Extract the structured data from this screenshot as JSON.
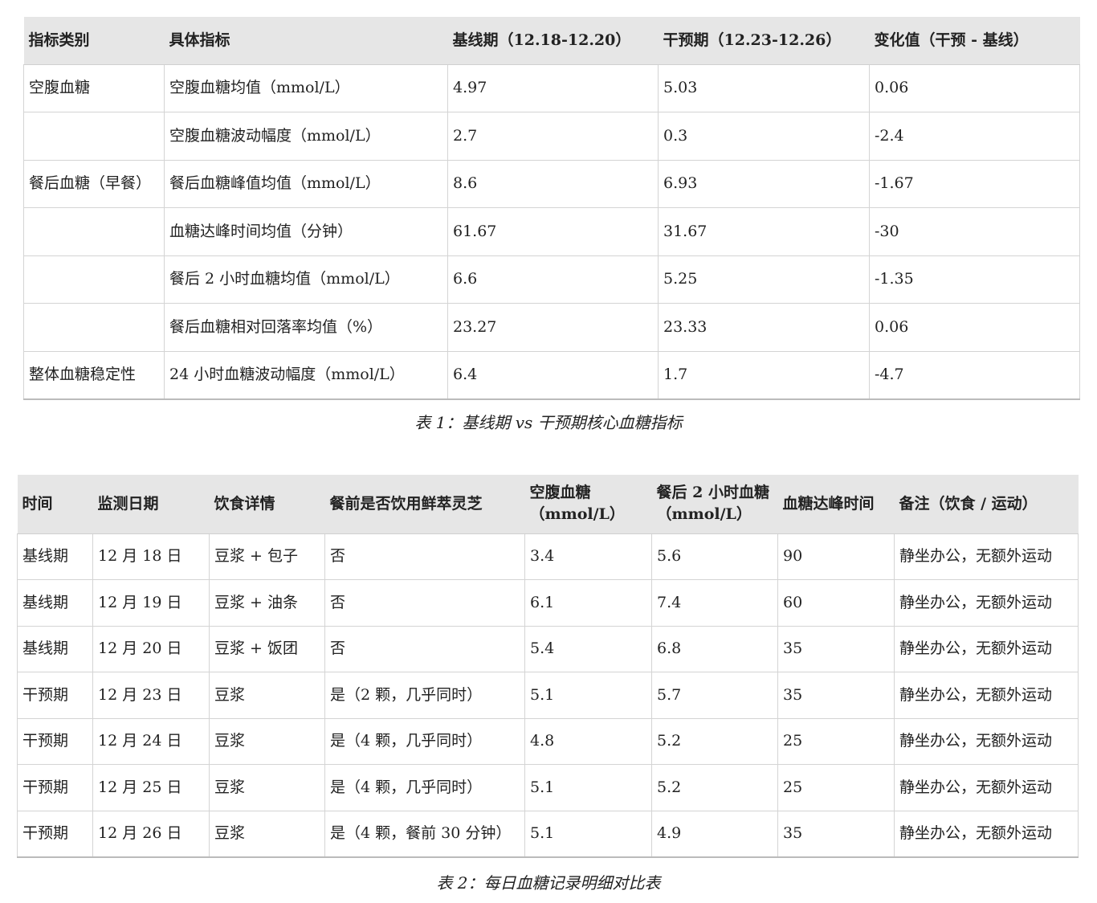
{
  "table1": {
    "headers": [
      "指标类别",
      "具体指标",
      "基线期（12.18-12.20）",
      "干预期（12.23-12.26）",
      "变化值（干预 - 基线）"
    ],
    "rows": [
      [
        "空腹血糖",
        "空腹血糖均值（mmol/L）",
        "4.97",
        "5.03",
        "0.06"
      ],
      [
        "",
        "空腹血糖波动幅度（mmol/L）",
        "2.7",
        "0.3",
        "-2.4"
      ],
      [
        "餐后血糖（早餐）",
        "餐后血糖峰值均值（mmol/L）",
        "8.6",
        "6.93",
        "-1.67"
      ],
      [
        "",
        "血糖达峰时间均值（分钟）",
        "61.67",
        "31.67",
        "-30"
      ],
      [
        "",
        "餐后 2 小时血糖均值（mmol/L）",
        "6.6",
        "5.25",
        "-1.35"
      ],
      [
        "",
        "餐后血糖相对回落率均值（%）",
        "23.27",
        "23.33",
        "0.06"
      ],
      [
        "整体血糖稳定性",
        "24 小时血糖波动幅度（mmol/L）",
        "6.4",
        "1.7",
        "-4.7"
      ]
    ],
    "caption": "表 1：基线期 vs 干预期核心血糖指标"
  },
  "table2": {
    "headers": [
      "时间",
      "监测日期",
      "饮食详情",
      "餐前是否饮用鲜萃灵芝",
      "空腹血糖（mmol/L）",
      "餐后 2 小时血糖（mmol/L）",
      "血糖达峰时间",
      "备注（饮食 / 运动）"
    ],
    "rows": [
      [
        "基线期",
        "12 月 18 日",
        "豆浆 + 包子",
        "否",
        "3.4",
        "5.6",
        "90",
        "静坐办公，无额外运动"
      ],
      [
        "基线期",
        "12 月 19 日",
        "豆浆 + 油条",
        "否",
        "6.1",
        "7.4",
        "60",
        "静坐办公，无额外运动"
      ],
      [
        "基线期",
        "12 月 20 日",
        "豆浆 + 饭团",
        "否",
        "5.4",
        "6.8",
        "35",
        "静坐办公，无额外运动"
      ],
      [
        "干预期",
        "12 月 23 日",
        "豆浆",
        "是（2 颗，几乎同时）",
        "5.1",
        "5.7",
        "35",
        "静坐办公，无额外运动"
      ],
      [
        "干预期",
        "12 月 24 日",
        "豆浆",
        "是（4 颗，几乎同时）",
        "4.8",
        "5.2",
        "25",
        "静坐办公，无额外运动"
      ],
      [
        "干预期",
        "12 月 25 日",
        "豆浆",
        "是（4 颗，几乎同时）",
        "5.1",
        "5.2",
        "25",
        "静坐办公，无额外运动"
      ],
      [
        "干预期",
        "12 月 26 日",
        "豆浆",
        "是（4 颗，餐前 30 分钟）",
        "5.1",
        "4.9",
        "35",
        "静坐办公，无额外运动"
      ]
    ],
    "caption": "表 2：每日血糖记录明细对比表"
  }
}
